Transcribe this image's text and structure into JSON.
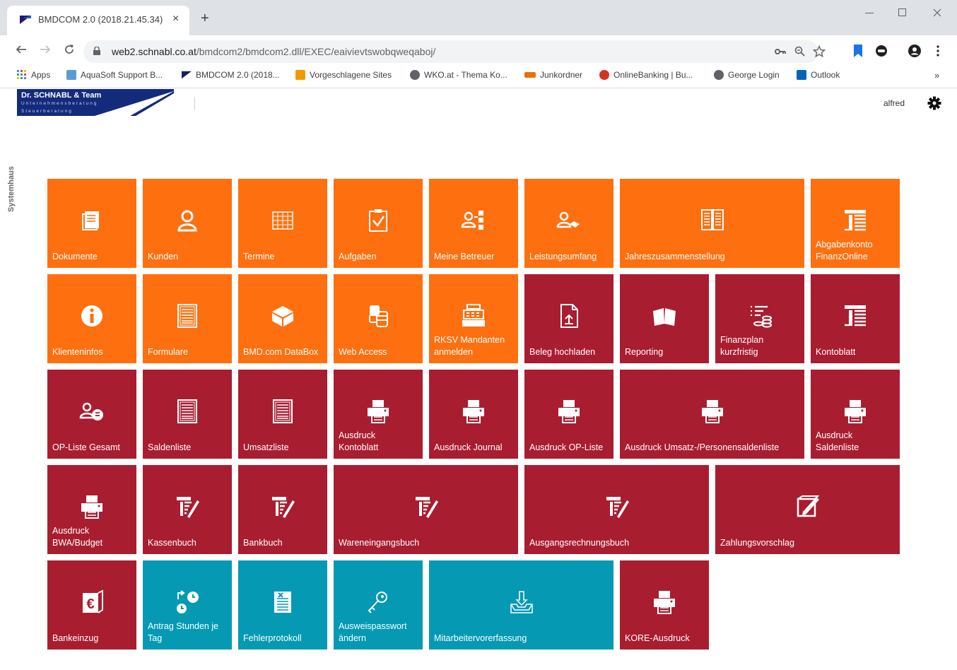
{
  "browser": {
    "tab_title": "BMDCOM 2.0 (2018.21.45.34)",
    "close_glyph": "×",
    "new_tab_glyph": "+",
    "url_host": "web2.schnabl.co.at",
    "url_path": "/bmdcom2/bmdcom2.dll/EXEC/eaivievtswobqweqaboj/",
    "bookmarks": [
      {
        "label": "Apps",
        "color": "#4285f4"
      },
      {
        "label": "AquaSoft Support B...",
        "color": "#5b9bd5"
      },
      {
        "label": "BMDCOM 2.0 (2018...",
        "color": "#1a1a6e"
      },
      {
        "label": "Vorgeschlagene Sites",
        "color": "#f29900"
      },
      {
        "label": "WKO.at - Thema Ko...",
        "color": "#5f6368"
      },
      {
        "label": "Junkordner",
        "color": "#e8710a"
      },
      {
        "label": "OnlineBanking | Bu...",
        "color": "#d93025"
      },
      {
        "label": "George Login",
        "color": "#5f6368"
      },
      {
        "label": "Outlook",
        "color": "#0364b8"
      }
    ],
    "more_glyph": "»"
  },
  "header": {
    "logo_name": "Dr. SCHNABL & Team",
    "logo_line1": "Unternehmensberatung",
    "logo_line2": "Steuerberatung",
    "user": "alfred",
    "side_label": "Systemhaus"
  },
  "colors": {
    "orange": "#fe6f0f",
    "red": "#a91d30",
    "teal": "#0599b3"
  },
  "tiles": [
    {
      "label": "Dokumente",
      "icon": "documents-icon"
    },
    {
      "label": "Kunden",
      "icon": "person-icon"
    },
    {
      "label": "Termine",
      "icon": "calendar-icon"
    },
    {
      "label": "Aufgaben",
      "icon": "clipboard-check-icon"
    },
    {
      "label": "Meine Betreuer",
      "icon": "advisors-icon"
    },
    {
      "label": "Leistungsumfang",
      "icon": "handshake-icon"
    },
    {
      "label": "Jahreszusammenstellung",
      "icon": "book-pages-icon"
    },
    {
      "label": "Abgabenkonto\nFinanzOnline",
      "icon": "ledger-icon"
    },
    {
      "label": "Klienteninfos",
      "icon": "info-icon"
    },
    {
      "label": "Formulare",
      "icon": "form-icon"
    },
    {
      "label": "BMD.com DataBox",
      "icon": "box-icon"
    },
    {
      "label": "Web Access",
      "icon": "database-icon"
    },
    {
      "label": "RKSV Mandanten\nanmelden",
      "icon": "cash-register-icon"
    },
    {
      "label": "Beleg hochladen",
      "icon": "upload-document-icon"
    },
    {
      "label": "Reporting",
      "icon": "open-book-icon"
    },
    {
      "label": "Finanzplan\nkurzfristig",
      "icon": "finance-plan-icon"
    },
    {
      "label": "Kontoblatt",
      "icon": "ledger-icon"
    },
    {
      "label": "OP-Liste Gesamt",
      "icon": "people-money-icon"
    },
    {
      "label": "Saldenliste",
      "icon": "form-icon"
    },
    {
      "label": "Umsatzliste",
      "icon": "form-icon"
    },
    {
      "label": "Ausdruck\nKontoblatt",
      "icon": "printer-icon"
    },
    {
      "label": "Ausdruck Journal",
      "icon": "printer-icon"
    },
    {
      "label": "Ausdruck OP-Liste",
      "icon": "printer-icon"
    },
    {
      "label": "Ausdruck Umsatz-/Personensaldenliste",
      "icon": "printer-icon"
    },
    {
      "label": "Ausdruck\nSaldenliste",
      "icon": "printer-icon"
    },
    {
      "label": "Ausdruck\nBWA/Budget",
      "icon": "printer-icon"
    },
    {
      "label": "Kassenbuch",
      "icon": "journal-pen-icon"
    },
    {
      "label": "Bankbuch",
      "icon": "journal-pen-icon"
    },
    {
      "label": "Wareneingangsbuch",
      "icon": "journal-pen-icon"
    },
    {
      "label": "Ausgangsrechnungsbuch",
      "icon": "journal-pen-icon"
    },
    {
      "label": "Zahlungsvorschlag",
      "icon": "edit-box-icon"
    },
    {
      "label": "Bankeinzug",
      "icon": "euro-icon"
    },
    {
      "label": "Antrag Stunden je\nTag",
      "icon": "clock-icon"
    },
    {
      "label": "Fehlerprotokoll",
      "icon": "error-log-icon"
    },
    {
      "label": "Ausweispasswort\nändern",
      "icon": "key-icon"
    },
    {
      "label": "Mitarbeitervorerfassung",
      "icon": "inbox-download-icon"
    },
    {
      "label": "KORE-Ausdruck",
      "icon": "printer-icon"
    }
  ]
}
